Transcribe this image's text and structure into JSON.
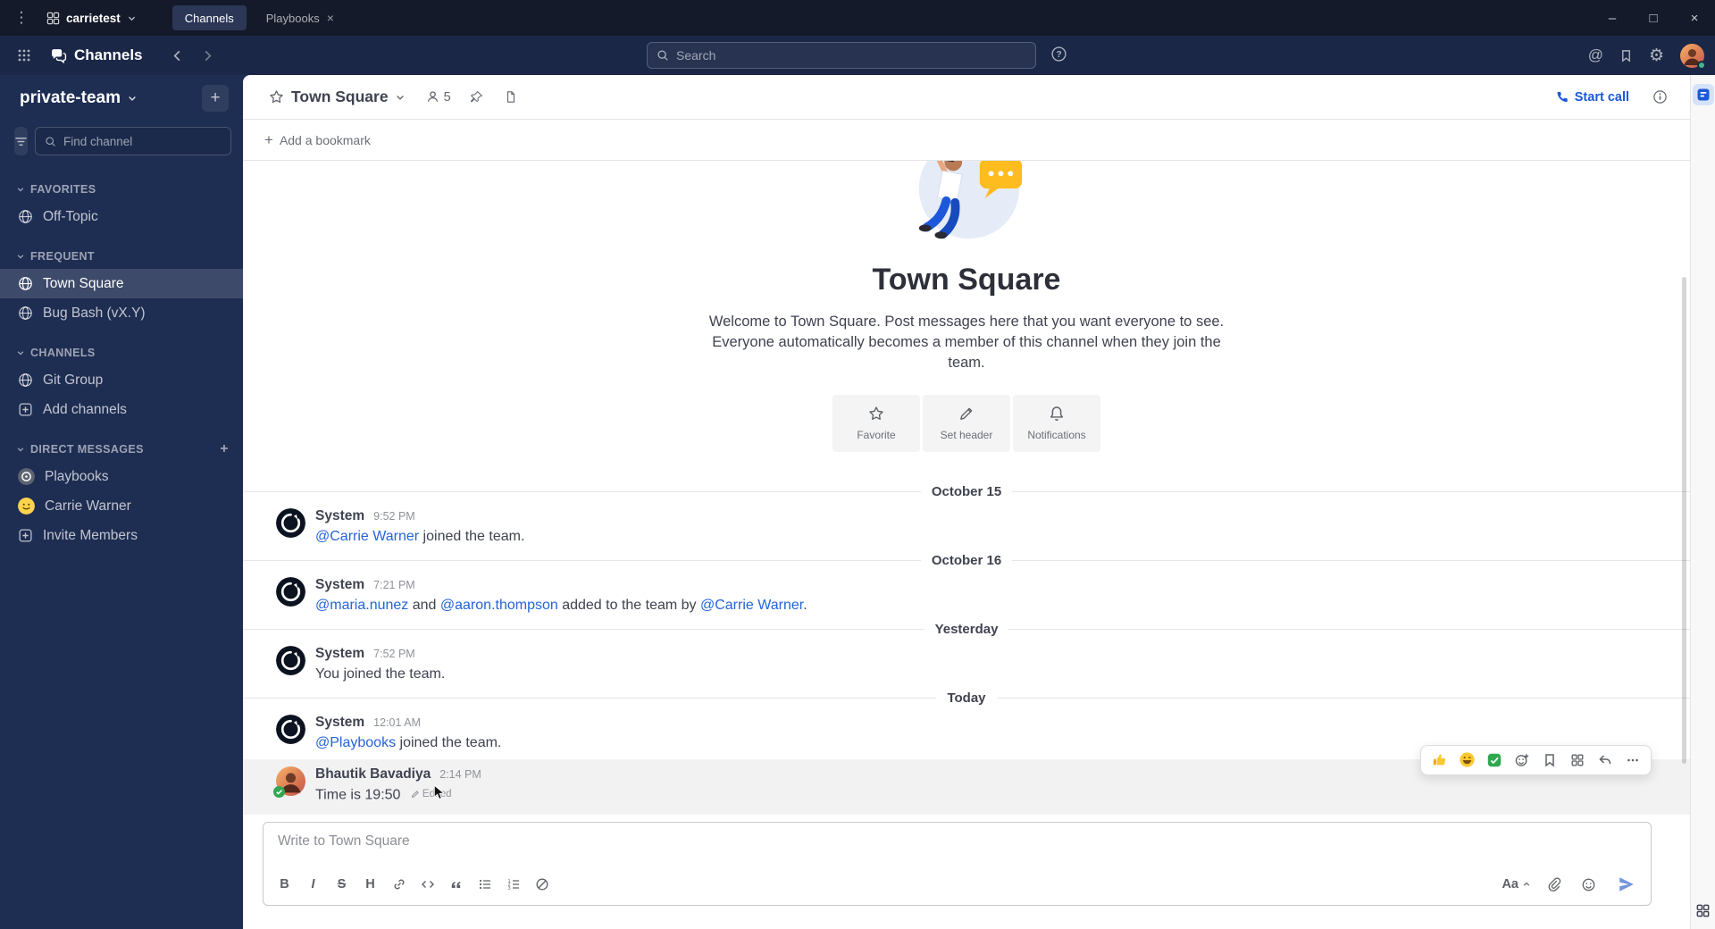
{
  "titlebar": {
    "server_name": "carrietest",
    "tab_channels": "Channels",
    "tab_playbooks": "Playbooks"
  },
  "global_header": {
    "product_name": "Channels",
    "search_placeholder": "Search"
  },
  "icons": {
    "app_menu": "⋮",
    "minimize": "–",
    "maximize": "□",
    "close": "×",
    "tab_close": "×",
    "at_mention": "@",
    "settings_gear": "⚙",
    "plus": "+"
  },
  "sidebar": {
    "team_name": "private-team",
    "find_channel_placeholder": "Find channel",
    "sections": [
      {
        "label": "FAVORITES",
        "items": [
          {
            "label": "Off-Topic"
          }
        ]
      },
      {
        "label": "FREQUENT",
        "items": [
          {
            "label": "Town Square"
          },
          {
            "label": "Bug Bash (vX.Y)"
          }
        ]
      },
      {
        "label": "CHANNELS",
        "items": [
          {
            "label": "Git Group"
          },
          {
            "label": "Add channels"
          }
        ]
      },
      {
        "label": "DIRECT MESSAGES",
        "items": [
          {
            "label": "Playbooks"
          },
          {
            "label": "Carrie Warner"
          },
          {
            "label": "Invite Members"
          }
        ]
      }
    ]
  },
  "channel_header": {
    "name": "Town Square",
    "member_count": "5",
    "start_call_label": "Start call"
  },
  "bookmark_bar": {
    "add_label": "Add a bookmark"
  },
  "intro": {
    "title": "Town Square",
    "description": "Welcome to Town Square. Post messages here that you want everyone to see. Everyone automatically becomes a member of this channel when they join the team.",
    "actions": [
      {
        "label": "Favorite"
      },
      {
        "label": "Set header"
      },
      {
        "label": "Notifications"
      }
    ]
  },
  "feed": {
    "dividers": [
      "October 15",
      "October 16",
      "Yesterday",
      "Today"
    ],
    "messages": [
      {
        "sender": "System",
        "time": "9:52 PM",
        "link1": "@Carrie Warner",
        "text1": " joined the team."
      },
      {
        "sender": "System",
        "time": "7:21 PM",
        "link1": "@maria.nunez",
        "text1": " and ",
        "link2": "@aaron.thompson",
        "text2": " added to the team by ",
        "link3": "@Carrie Warner",
        "text3": "."
      },
      {
        "sender": "System",
        "time": "7:52 PM",
        "text1": "You joined the team."
      },
      {
        "sender": "System",
        "time": "12:01 AM",
        "link1": "@Playbooks",
        "text1": " joined the team."
      },
      {
        "sender": "Bhautik Bavadiya",
        "time": "2:14 PM",
        "text1": "Time is 19:50",
        "edited": "Edited"
      }
    ],
    "quick_reactions": [
      "thumbs-up",
      "grinning-face",
      "white-check-mark"
    ]
  },
  "composer": {
    "placeholder": "Write to Town Square",
    "bold": "B",
    "italic": "I",
    "strike": "S",
    "heading": "H",
    "format_toggle": "Aa"
  },
  "colors": {
    "accent_blue": "#1c58d9",
    "link_blue": "#2464d9",
    "titlebar_bg": "#141a29",
    "header_bg": "#1a2747",
    "sidebar_bg": "#1e2d52",
    "online_green": "#3db887"
  }
}
